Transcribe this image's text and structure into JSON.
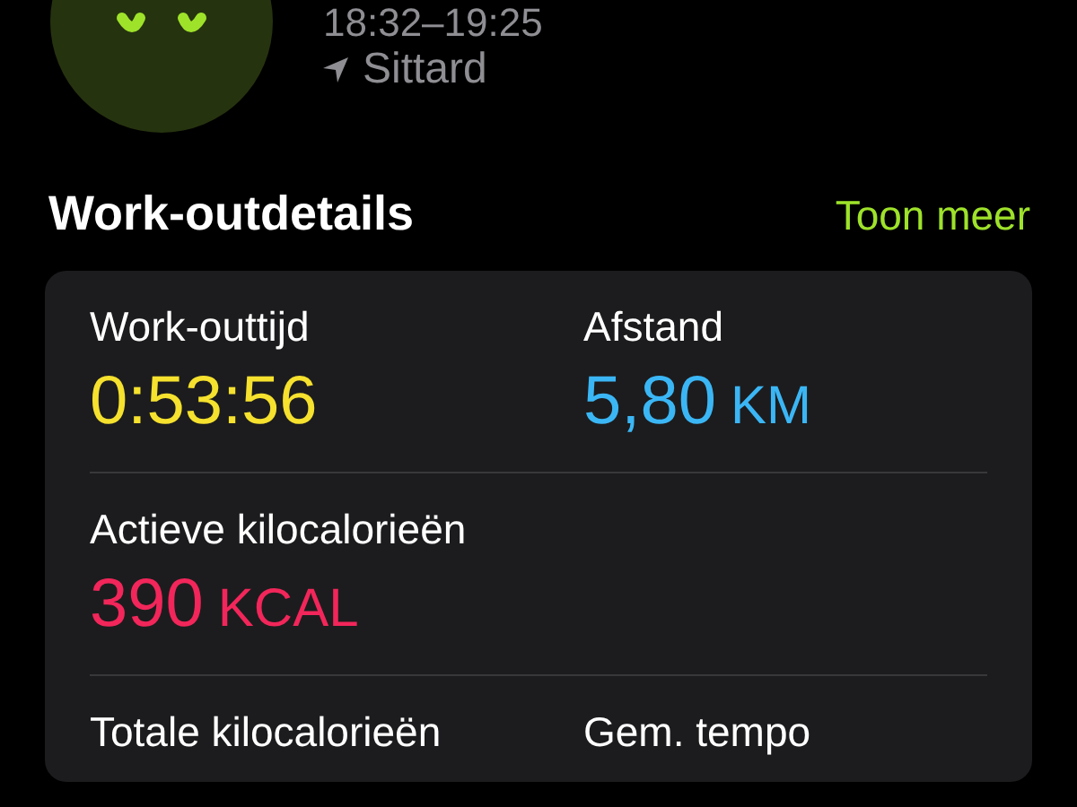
{
  "workout": {
    "time_range": "18:32–19:25",
    "location": "Sittard"
  },
  "section": {
    "title": "Work-outdetails",
    "link": "Toon meer"
  },
  "metric_rows": [
    {
      "metrics": [
        {
          "label": "Work-outtijd",
          "value": "0:53:56",
          "color": "#f5e12e"
        },
        {
          "label": "Afstand",
          "value": "5,80",
          "unit": "KM",
          "color": "#3bb6f5"
        }
      ]
    },
    {
      "metrics": [
        {
          "label": "Actieve kilocalorieën",
          "value": "390",
          "unit": "KCAL",
          "color": "#f2265a"
        }
      ]
    },
    {
      "metrics": [
        {
          "label": "Totale kilocalorieën"
        },
        {
          "label": "Gem. tempo"
        }
      ]
    }
  ]
}
